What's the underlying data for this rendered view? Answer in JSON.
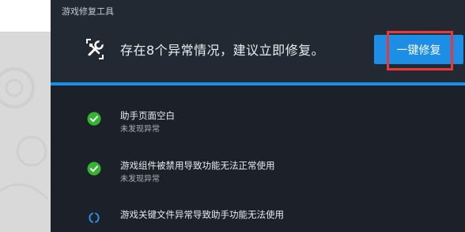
{
  "window": {
    "title": "游戏修复工具"
  },
  "summary": {
    "text": "存在8个异常情况，建议立即修复。",
    "icon": "tools-icon"
  },
  "actions": {
    "fix_all_label": "一键修复"
  },
  "colors": {
    "accent": "#1c8ee6",
    "ok": "#35b432",
    "highlight": "#e8383a",
    "panel": "#1c2129"
  },
  "checks": [
    {
      "title": "助手页面空白",
      "status": "未发现异常",
      "icon": "check-circle-icon"
    },
    {
      "title": "游戏组件被禁用导致功能无法正常使用",
      "status": "未发现异常",
      "icon": "check-circle-icon"
    },
    {
      "title": "游戏关键文件异常导致助手功能无法使用",
      "status": "",
      "icon": "loading-spinner-icon"
    }
  ]
}
